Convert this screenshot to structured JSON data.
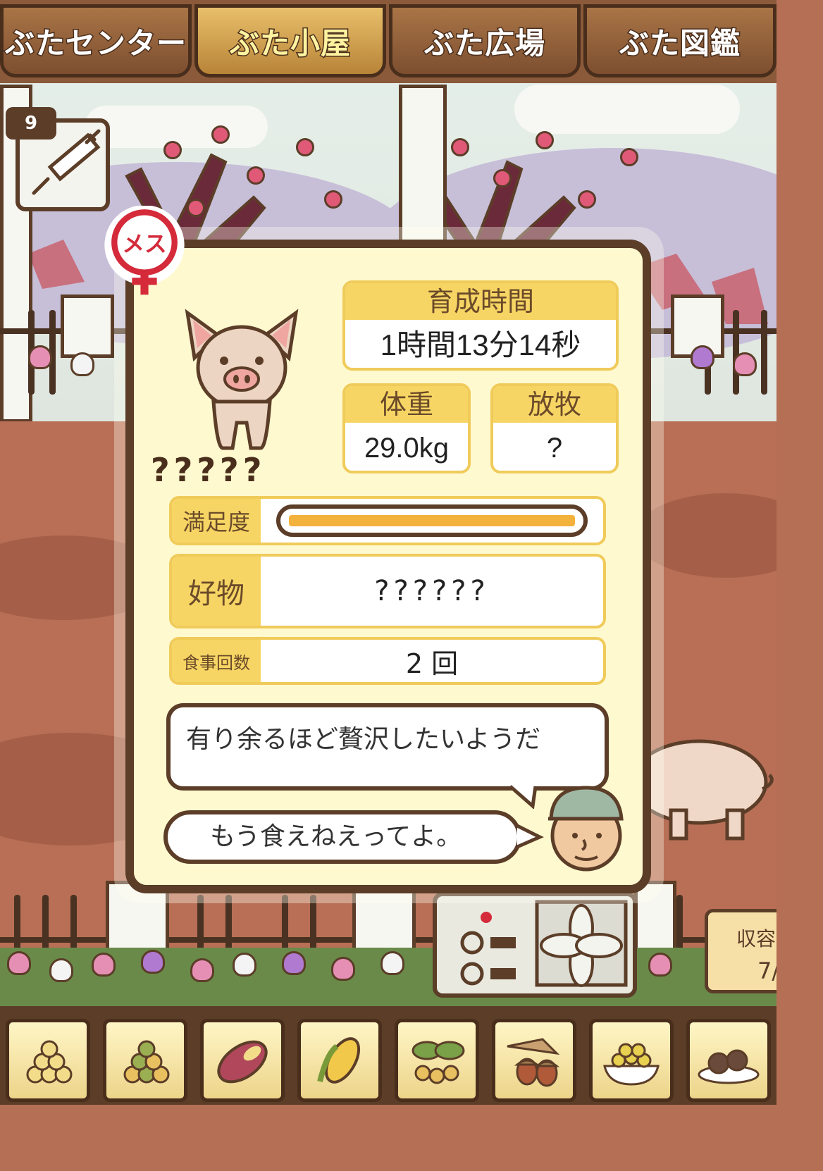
{
  "nav": {
    "tabs": [
      {
        "label": "ぶたセンター"
      },
      {
        "label": "ぶた小屋"
      },
      {
        "label": "ぶた広場"
      },
      {
        "label": "ぶた図鑑"
      }
    ]
  },
  "item": {
    "count": "9",
    "icon": "syringe-icon"
  },
  "pig": {
    "gender_label": "メス",
    "name": "?????",
    "growth_time_label": "育成時間",
    "growth_time_value": "1時間13分14秒",
    "weight_label": "体重",
    "weight_value": "29.0kg",
    "grazing_label": "放牧",
    "grazing_value": "?",
    "satisfaction_label": "満足度",
    "satisfaction_level": 1.0,
    "favorite_label": "好物",
    "favorite_value": "??????",
    "meals_label": "食事回数",
    "meals_value": "2 回"
  },
  "dialog": {
    "status_text": "有り余るほど贅沢したいようだ",
    "farmer_text": "もう食えねえってよ。"
  },
  "capacity": {
    "label": "収容",
    "value": "7/"
  },
  "colors": {
    "accent_yellow": "#f6d564",
    "panel_bg": "#fff9cf",
    "border_brown": "#5b3d28",
    "gauge_fill": "#f2b23c",
    "gender_red": "#d42a3a"
  },
  "food_items": [
    {
      "icon": "soybean-pile-icon"
    },
    {
      "icon": "green-bean-pile-icon"
    },
    {
      "icon": "sweet-potato-icon"
    },
    {
      "icon": "corn-icon"
    },
    {
      "icon": "leafy-plant-icon"
    },
    {
      "icon": "acorn-icon"
    },
    {
      "icon": "grain-bowl-icon"
    },
    {
      "icon": "dark-ball-plate-icon"
    }
  ]
}
